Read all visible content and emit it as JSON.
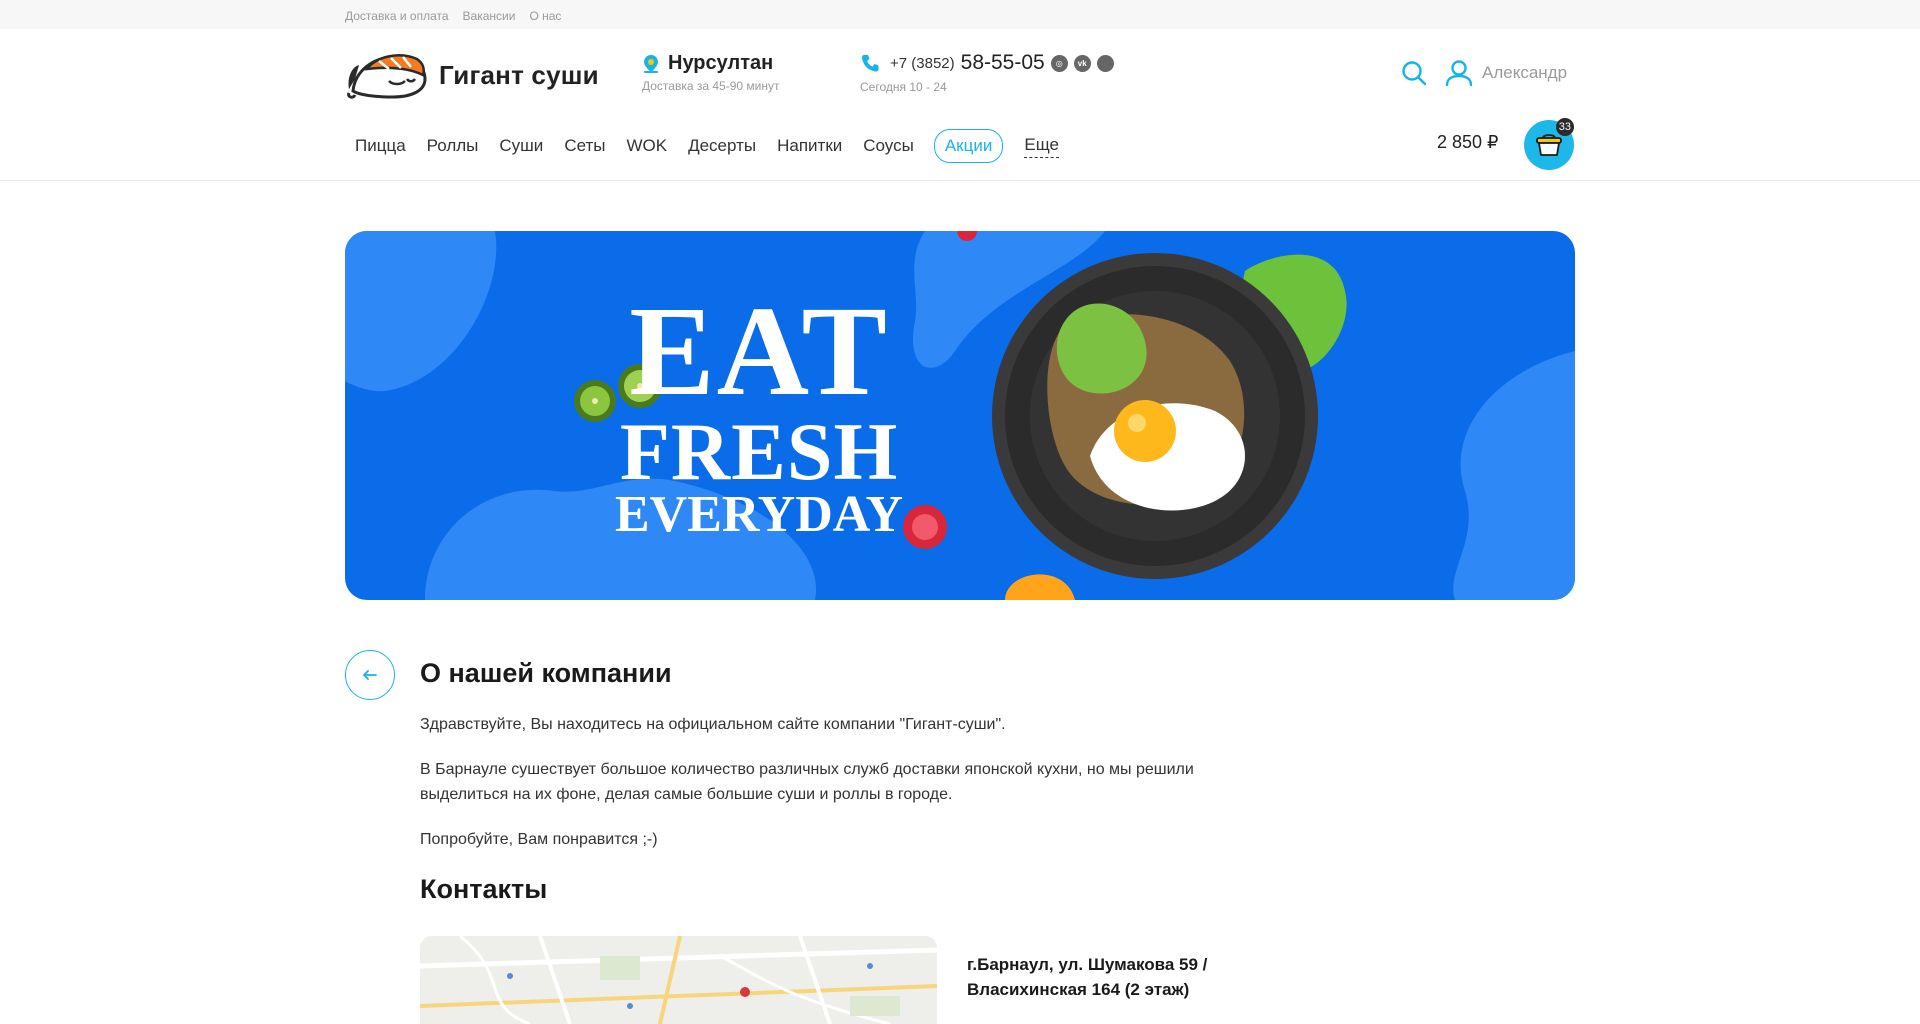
{
  "topbar": {
    "links": [
      "Доставка и оплата",
      "Вакансии",
      "О нас"
    ]
  },
  "header": {
    "logo_title": "Гигант суши",
    "city": "Нурсултан",
    "delivery_time": "Доставка за 45-90 минут",
    "phone_prefix": "+7 (3852)",
    "phone_number": "58-55-05",
    "hours": "Сегодня 10 - 24",
    "user_name": "Александр",
    "social_icons": [
      "instagram-icon",
      "vk-icon",
      "circle-icon"
    ]
  },
  "nav": {
    "items": [
      "Пицца",
      "Роллы",
      "Суши",
      "Сеты",
      "WOK",
      "Десерты",
      "Напитки",
      "Соусы"
    ],
    "promo": "Акции",
    "more": "Еще"
  },
  "cart": {
    "total": "2 850 ₽",
    "count": "33"
  },
  "banner": {
    "line1": "EAT",
    "line2": "FRESH",
    "line3": "EVERYDAY"
  },
  "about": {
    "title": "О нашей компании",
    "paragraphs": [
      "Здравствуйте, Вы находитесь на официальном сайте компании \"Гигант-суши\".",
      "В Барнауле сушествует большое количество различных служб доставки японской кухни, но мы решили выделиться на их фоне, делая самые большие суши и роллы в городе.",
      "Попробуйте, Вам понравится ;-)"
    ]
  },
  "contacts": {
    "title": "Контакты",
    "address": "г.Барнаул, ул. Шумакова 59 / Власихинская 164 (2 этаж)"
  },
  "colors": {
    "accent": "#18b4e8",
    "banner_bg": "#0a6ce8"
  }
}
